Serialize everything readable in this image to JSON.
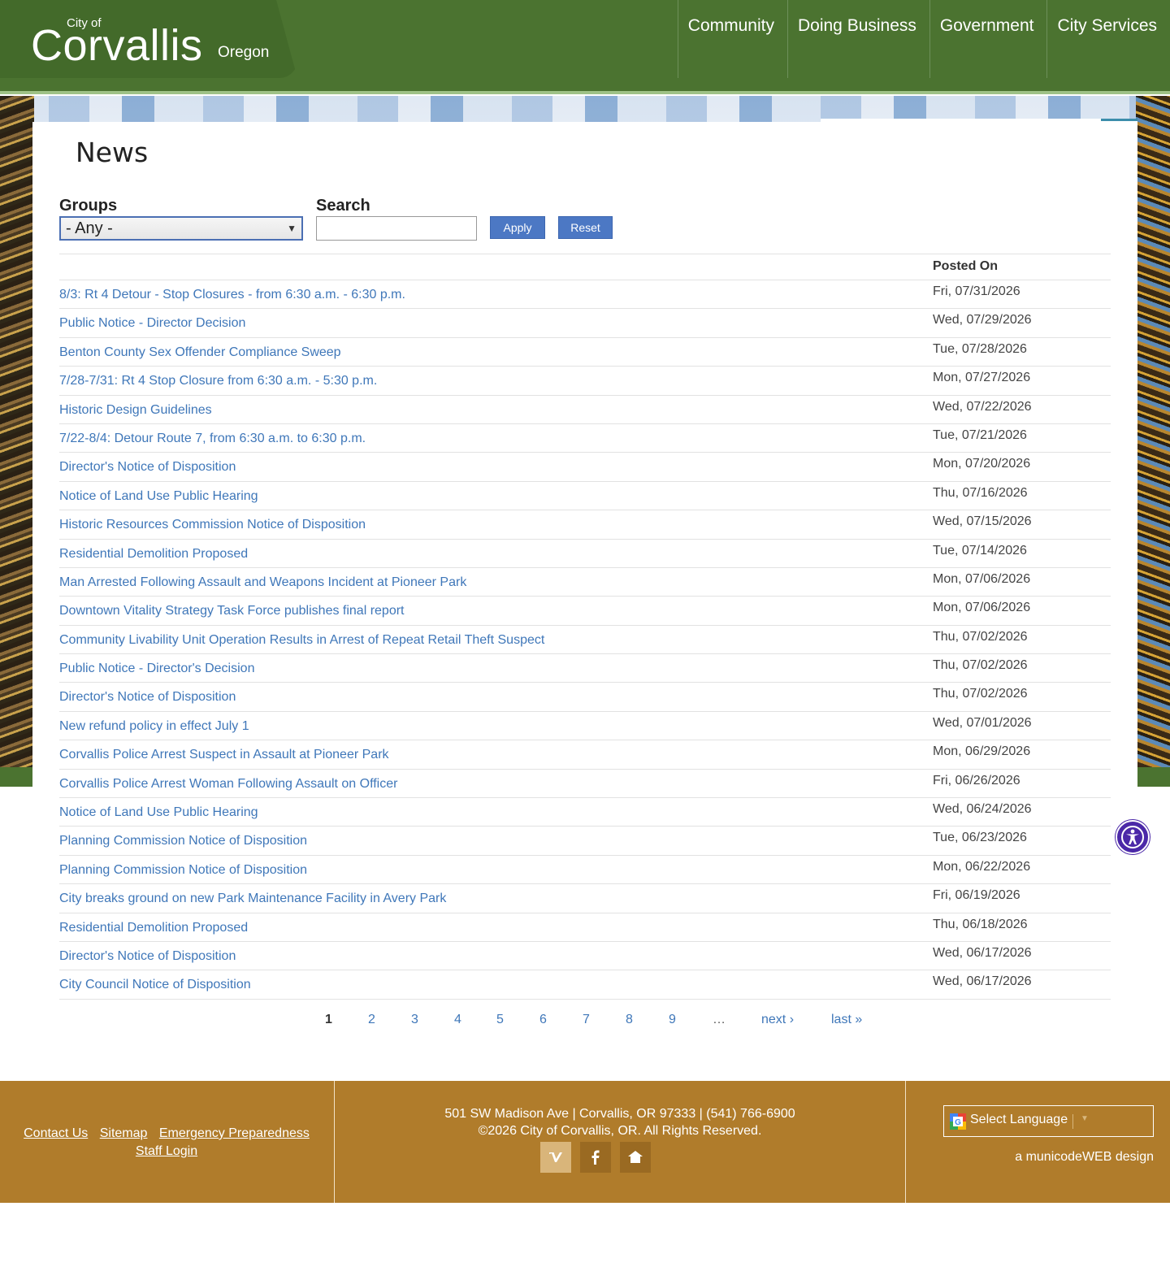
{
  "header": {
    "logo_prefix": "City of",
    "logo_name": "Corvallis",
    "logo_state": "Oregon",
    "nav": [
      "Community",
      "Doing Business",
      "Government",
      "City Services"
    ]
  },
  "page": {
    "title": "News"
  },
  "filters": {
    "groups_label": "Groups",
    "groups_value": "- Any -",
    "search_label": "Search",
    "search_value": "",
    "apply_label": "Apply",
    "reset_label": "Reset"
  },
  "table": {
    "date_header": "Posted On",
    "rows": [
      {
        "title": "8/3: Rt 4 Detour - Stop Closures - from 6:30 a.m. - 6:30 p.m.",
        "date": "Fri, 07/31/2026"
      },
      {
        "title": "Public Notice - Director Decision",
        "date": "Wed, 07/29/2026"
      },
      {
        "title": "Benton County Sex Offender Compliance Sweep",
        "date": "Tue, 07/28/2026"
      },
      {
        "title": "7/28-7/31: Rt 4 Stop Closure from 6:30 a.m. - 5:30 p.m.",
        "date": "Mon, 07/27/2026"
      },
      {
        "title": "Historic Design Guidelines",
        "date": "Wed, 07/22/2026"
      },
      {
        "title": "7/22-8/4: Detour Route 7, from 6:30 a.m. to 6:30 p.m.",
        "date": "Tue, 07/21/2026"
      },
      {
        "title": "Director's Notice of Disposition",
        "date": "Mon, 07/20/2026"
      },
      {
        "title": "Notice of Land Use Public Hearing",
        "date": "Thu, 07/16/2026"
      },
      {
        "title": "Historic Resources Commission Notice of Disposition",
        "date": "Wed, 07/15/2026"
      },
      {
        "title": "Residential Demolition Proposed",
        "date": "Tue, 07/14/2026"
      },
      {
        "title": "Man Arrested Following Assault and Weapons Incident at Pioneer Park",
        "date": "Mon, 07/06/2026"
      },
      {
        "title": "Downtown Vitality Strategy Task Force publishes final report",
        "date": "Mon, 07/06/2026"
      },
      {
        "title": "Community Livability Unit Operation Results in Arrest of Repeat Retail Theft Suspect",
        "date": "Thu, 07/02/2026"
      },
      {
        "title": "Public Notice - Director's Decision",
        "date": "Thu, 07/02/2026"
      },
      {
        "title": "Director's Notice of Disposition",
        "date": "Thu, 07/02/2026"
      },
      {
        "title": "New refund policy in effect July 1",
        "date": "Wed, 07/01/2026"
      },
      {
        "title": "Corvallis Police Arrest Suspect in Assault at Pioneer Park",
        "date": "Mon, 06/29/2026"
      },
      {
        "title": "Corvallis Police Arrest Woman Following Assault on Officer",
        "date": "Fri, 06/26/2026"
      },
      {
        "title": "Notice of Land Use Public Hearing",
        "date": "Wed, 06/24/2026"
      },
      {
        "title": "Planning Commission Notice of Disposition",
        "date": "Tue, 06/23/2026"
      },
      {
        "title": "Planning Commission Notice of Disposition",
        "date": "Mon, 06/22/2026"
      },
      {
        "title": "City breaks ground on new Park Maintenance Facility in Avery Park",
        "date": "Fri, 06/19/2026"
      },
      {
        "title": "Residential Demolition Proposed",
        "date": "Thu, 06/18/2026"
      },
      {
        "title": "Director's Notice of Disposition",
        "date": "Wed, 06/17/2026"
      },
      {
        "title": "City Council Notice of Disposition",
        "date": "Wed, 06/17/2026"
      }
    ]
  },
  "pager": {
    "items": [
      {
        "label": "1",
        "kind": "current"
      },
      {
        "label": "2",
        "kind": "page"
      },
      {
        "label": "3",
        "kind": "page"
      },
      {
        "label": "4",
        "kind": "page"
      },
      {
        "label": "5",
        "kind": "page"
      },
      {
        "label": "6",
        "kind": "page"
      },
      {
        "label": "7",
        "kind": "page"
      },
      {
        "label": "8",
        "kind": "page"
      },
      {
        "label": "9",
        "kind": "page"
      },
      {
        "label": "…",
        "kind": "ellipsis"
      },
      {
        "label": "next ›",
        "kind": "next"
      },
      {
        "label": "last »",
        "kind": "last"
      }
    ]
  },
  "footer": {
    "links": [
      "Contact Us",
      "Sitemap",
      "Emergency Preparedness",
      "Staff Login"
    ],
    "address": "501 SW Madison Ave | Corvallis, OR 97333 | (541) 766-6900",
    "copyright": "©2026 City of Corvallis, OR. All Rights Reserved.",
    "social_icons": [
      "vimeo-icon",
      "facebook-icon",
      "nextdoor-icon"
    ],
    "language_label": "Select Language",
    "credit": "a municodeWEB design"
  },
  "colors": {
    "header_green": "#4b7330",
    "link_blue": "#3f77b9",
    "button_blue": "#4c78c4",
    "footer_brown": "#b07c2b",
    "accessibility_purple": "#4b28a8"
  }
}
